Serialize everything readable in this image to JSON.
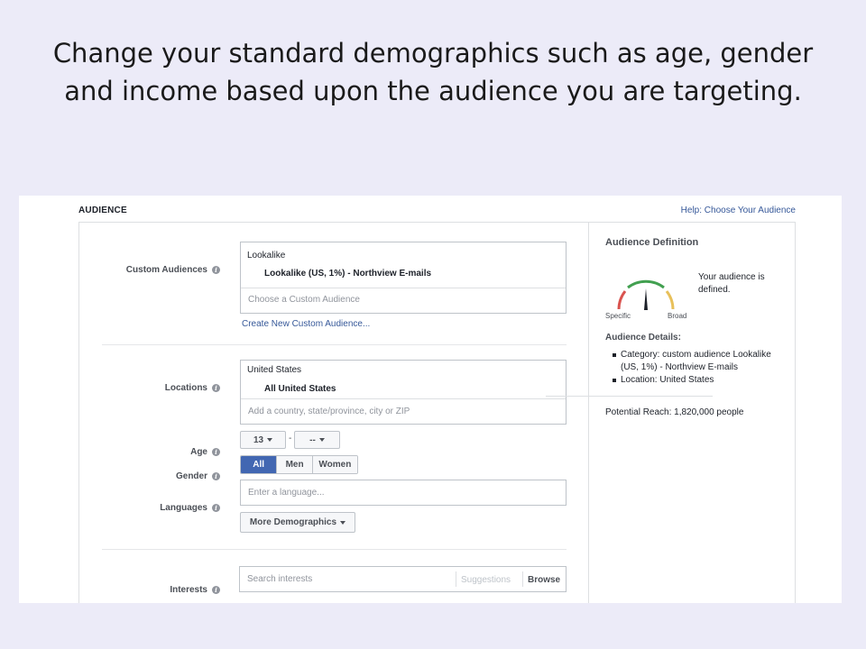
{
  "slide": {
    "title": "Change your standard demographics such as age, gender and income based upon the audience you are targeting."
  },
  "section": {
    "title": "AUDIENCE",
    "help_link": "Help: Choose Your Audience"
  },
  "custom_audiences": {
    "label": "Custom Audiences",
    "group": "Lookalike",
    "selected": "Lookalike (US, 1%) - Northview E-mails",
    "placeholder": "Choose a Custom Audience",
    "create_link": "Create New Custom Audience..."
  },
  "locations": {
    "label": "Locations",
    "group": "United States",
    "selected": "All United States",
    "placeholder": "Add a country, state/province, city or ZIP"
  },
  "age": {
    "label": "Age",
    "min": "13",
    "separator": "-",
    "max": "--"
  },
  "gender": {
    "label": "Gender",
    "options": [
      "All",
      "Men",
      "Women"
    ],
    "selected": "All"
  },
  "languages": {
    "label": "Languages",
    "placeholder": "Enter a language..."
  },
  "more_demographics": {
    "label": "More Demographics"
  },
  "interests": {
    "label": "Interests",
    "placeholder": "Search interests",
    "suggestions": "Suggestions",
    "browse": "Browse"
  },
  "audience_definition": {
    "title": "Audience Definition",
    "gauge_min_label": "Specific",
    "gauge_max_label": "Broad",
    "gauge_level": 0.5,
    "status": "Your audience is defined.",
    "details_title": "Audience Details:",
    "details": [
      "Category: custom audience Lookalike (US, 1%) - Northview E-mails",
      "Location: United States"
    ],
    "potential_reach": "Potential Reach: 1,820,000 people"
  },
  "colors": {
    "link": "#365899",
    "active_button": "#4267b2",
    "gauge_red": "#d9534f",
    "gauge_green": "#42a050",
    "gauge_yellow": "#e8c05a"
  }
}
